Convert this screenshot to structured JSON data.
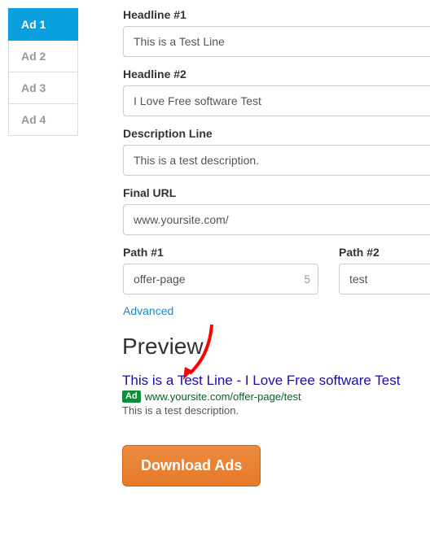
{
  "tabs": [
    {
      "label": "Ad 1",
      "active": true
    },
    {
      "label": "Ad 2",
      "active": false
    },
    {
      "label": "Ad 3",
      "active": false
    },
    {
      "label": "Ad 4",
      "active": false
    }
  ],
  "form": {
    "headline1": {
      "label": "Headline #1",
      "value": "This is a Test Line"
    },
    "headline2": {
      "label": "Headline #2",
      "value": "I Love Free software Test"
    },
    "description": {
      "label": "Description Line",
      "value": "This is a test description."
    },
    "final_url": {
      "label": "Final URL",
      "value": "www.yoursite.com/"
    },
    "path1": {
      "label": "Path #1",
      "value": "offer-page",
      "counter": "5"
    },
    "path2": {
      "label": "Path #2",
      "value": "test"
    },
    "advanced_label": "Advanced"
  },
  "preview": {
    "title": "Preview",
    "headline": "This is a Test Line - I Love Free software Test",
    "ad_badge": "Ad",
    "url": "www.yoursite.com/offer-page/test",
    "description": "This is a test description."
  },
  "download_button": "Download Ads"
}
